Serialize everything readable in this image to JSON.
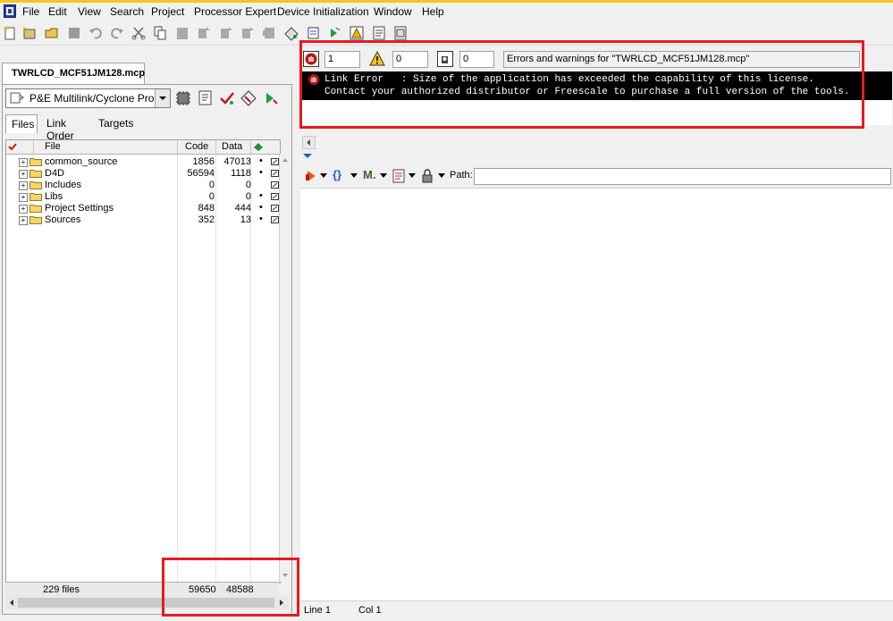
{
  "menu": [
    "File",
    "Edit",
    "View",
    "Search",
    "Project",
    "Processor Expert",
    "Device Initialization",
    "Window",
    "Help"
  ],
  "project": {
    "tab_title": "TWRLCD_MCF51JM128.mcp",
    "target": "P&E Multilink/Cyclone Pro",
    "tabs": [
      "Files",
      "Link Order",
      "Targets"
    ],
    "columns": {
      "file": "File",
      "code": "Code",
      "data": "Data"
    },
    "rows": [
      {
        "name": "common_source",
        "code": "1856",
        "data": "47013"
      },
      {
        "name": "D4D",
        "code": "56594",
        "data": "1118"
      },
      {
        "name": "Includes",
        "code": "0",
        "data": "0"
      },
      {
        "name": "Libs",
        "code": "0",
        "data": "0"
      },
      {
        "name": "Project Settings",
        "code": "848",
        "data": "444"
      },
      {
        "name": "Sources",
        "code": "352",
        "data": "13"
      }
    ],
    "footer": {
      "files": "229 files",
      "code_total": "59650",
      "data_total": "48588"
    }
  },
  "messages": {
    "error_count": "1",
    "warning_count": "0",
    "info_count": "0",
    "title": "Errors and warnings for \"TWRLCD_MCF51JM128.mcp\"",
    "line1": "Link Error   : Size of the application has exceeded the capability of this license.",
    "line2": "Contact your authorized distributor or Freescale to purchase a full version of the tools."
  },
  "editor": {
    "path_label": "Path:",
    "path_value": ""
  },
  "status": {
    "line": "Line 1",
    "col": "Col 1"
  },
  "colors": {
    "highlight": "#e51c23",
    "topstrip": "#f5c518"
  }
}
